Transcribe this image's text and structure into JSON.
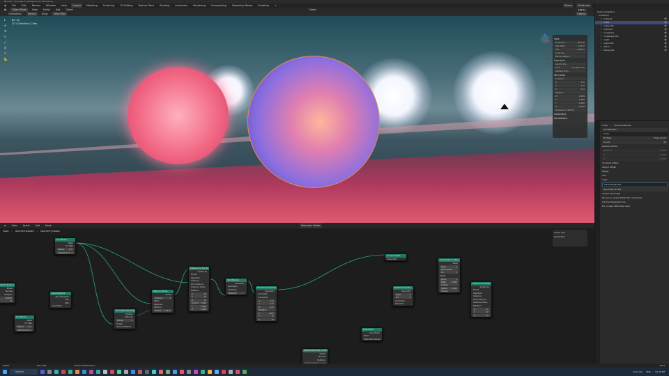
{
  "title": "Blender* [D:\\August 2023\\geonode ball.blend]",
  "menu": [
    "File",
    "Edit",
    "Render",
    "Window",
    "Help"
  ],
  "workspaces": [
    "Layout",
    "Modeling",
    "Sculpting",
    "UV Editing",
    "Texture Paint",
    "Shading",
    "Animation",
    "Rendering",
    "Compositing",
    "Geometry Nodes",
    "Scripting",
    "+"
  ],
  "scene": {
    "label": "Scene",
    "view_layer": "ViewLayer"
  },
  "viewport_header": {
    "mode": "Object Mode",
    "menus": [
      "View",
      "Select",
      "Add",
      "Object"
    ],
    "orientation_global": "Global",
    "options": "Options"
  },
  "tool_settings": {
    "orientation_label": "Orientation:",
    "orientation": "Default",
    "drag_label": "Drag:",
    "drag": "Select Box"
  },
  "viewport_overlay": {
    "line1": "Bx: 14",
    "line2": "(17) Collection | Cube"
  },
  "npanel": {
    "view_header": "View",
    "fields": [
      {
        "k": "Focal Len...",
        "v": "50 mm"
      },
      {
        "k": "Clip Start",
        "v": "0.01 m"
      },
      {
        "k": "End",
        "v": "1000 m"
      }
    ],
    "local_camera": "Local Ca...",
    "render_region": "Render Region",
    "view_lock": "View Lock",
    "lock_to_obj": "Lock to Ob...",
    "lock": "Lock",
    "to_cursor": "To 3D Cursor",
    "camera_to_view": "Camera to Vi...",
    "cursor_header": "3D Cursor",
    "location": "Location",
    "loc": [
      {
        "k": "X",
        "v": "0 m"
      },
      {
        "k": "Y",
        "v": "0 m"
      },
      {
        "k": "Z",
        "v": "0 m"
      }
    ],
    "rotation": "Rotation",
    "rot": [
      {
        "k": "W",
        "v": "0.000"
      },
      {
        "k": "X",
        "v": "0.000"
      },
      {
        "k": "Y",
        "v": "0.000"
      },
      {
        "k": "Z",
        "v": "0.000"
      }
    ],
    "rot_mode": "Quaternion (WXYZ)",
    "collections": "Collections",
    "annotations": "Annotations"
  },
  "outliner": {
    "root": "Scene Collection",
    "collection": "Collection",
    "items": [
      "Camera",
      "Cube",
      "Cube.001",
      "Cylinder",
      "Icosphere",
      "Icosphere.001",
      "Light",
      "Light.001",
      "Plane",
      "Plane.001"
    ],
    "selected": 1
  },
  "properties": {
    "object": "Cube",
    "modifier_name": "GeometryNodes",
    "add_modifier": "Add Modifier",
    "array": {
      "name": "Array",
      "fit_type_label": "Fit Type",
      "fit_type": "Fixed Count",
      "count_label": "Count",
      "count": "10",
      "relative_offset": "Relative Offset",
      "factors": [
        {
          "k": "Factor X",
          "v": "1.000"
        },
        {
          "k": "Y",
          "v": "0.000"
        },
        {
          "k": "Z",
          "v": "0.000"
        }
      ],
      "constant_offset": "Constant Offset",
      "object_offset": "Object Offset",
      "merge": "Merge",
      "uvs": "UVs",
      "caps": "Caps"
    },
    "geonodes": {
      "name": "GeometryNodes",
      "tree": "Geometry Nodes",
      "output_attributes": "Output Attributes",
      "no_group_output": "No group output attributes connected",
      "internal_dependencies": "Internal Dependencies",
      "no_unused": "No unused attributes used"
    }
  },
  "node_editor": {
    "menus": [
      "View",
      "Select",
      "Add",
      "Node"
    ],
    "tree": "Geometry Nodes",
    "breadcrumbs": [
      "Cube",
      "GeometryNodes",
      "Geometry Nodes"
    ],
    "sidebar": {
      "header": "Active Tool",
      "tool": "Select Box"
    },
    "nodes": [
      {
        "title": "Distribute Points on Faces",
        "out": [
          "Points",
          "Normal",
          "Rotation"
        ],
        "vals": [
          {
            "k": "",
            "v": "10.000"
          },
          {
            "k": "",
            "v": "0"
          }
        ]
      },
      {
        "title": "Ico Sphere",
        "out": [
          "Mesh",
          "UV Map"
        ],
        "vals": [
          {
            "k": "Radius",
            "v": "1 m"
          },
          {
            "k": "Subdivisions",
            "v": "3"
          }
        ]
      },
      {
        "title": "Bounding Box",
        "out": [
          "Bounding Box",
          "Min",
          "Max"
        ],
        "in": [
          "Geometry"
        ]
      },
      {
        "title": "Ico Sphere",
        "out": [
          "Mesh",
          "UV Map"
        ],
        "vals": [
          {
            "k": "Radius",
            "v": "1 m"
          },
          {
            "k": "Subdivisions",
            "v": "1"
          }
        ]
      },
      {
        "title": "Geometry Proximity",
        "out": [
          "Position",
          "Distance"
        ],
        "mode": "Points",
        "in": [
          "Target",
          "Source Position"
        ]
      },
      {
        "title": "Mesh to Points",
        "out": [
          "Points"
        ],
        "mode": "Vertices",
        "in": [
          "Mesh",
          "Selection",
          "Position"
        ],
        "vals": [
          {
            "k": "Radius",
            "v": "0.05 m"
          }
        ]
      },
      {
        "title": "Instance on Points",
        "out": [
          "Instances"
        ],
        "in": [
          "Points",
          "Selection",
          "Instance",
          "Pick Instance",
          "Instance Index",
          "Rotation"
        ],
        "vals": [
          {
            "k": "X",
            "v": "0°"
          },
          {
            "k": "Y",
            "v": "0°"
          },
          {
            "k": "Z",
            "v": "0°"
          },
          {
            "k": "Scale X",
            "v": "1.000"
          },
          {
            "k": "Y",
            "v": "1.000"
          },
          {
            "k": "Z",
            "v": "1.000"
          }
        ]
      },
      {
        "title": "Set Material",
        "out": [
          "Geometry"
        ],
        "in": [
          "Geometry",
          "Selection"
        ],
        "vals": [
          {
            "k": "Material",
            "v": ""
          }
        ]
      },
      {
        "title": "Transform Geometry",
        "out": [
          "Geometry"
        ],
        "in": [
          "Geometry",
          "Translation"
        ],
        "vals": [
          {
            "k": "X",
            "v": "0 m"
          },
          {
            "k": "Y",
            "v": "0 m"
          },
          {
            "k": "Z",
            "v": "0 m"
          },
          {
            "k": "Rotation",
            "v": ""
          },
          {
            "k": "X",
            "v": "360°"
          },
          {
            "k": "Y",
            "v": "0°"
          },
          {
            "k": "Z",
            "v": "0°"
          }
        ]
      },
      {
        "title": "Group Output",
        "in": [
          "Geometry"
        ]
      },
      {
        "title": "Delete Geometry",
        "out": [
          "Geometry"
        ],
        "mode": "Edge",
        "mode2": "All",
        "in": [
          "Geometry",
          "Selection"
        ]
      },
      {
        "title": "Subdivision Surface",
        "out": [
          "Mesh"
        ],
        "mode": "Keep Boundaries",
        "mode2": "All",
        "in": [
          "Mesh"
        ],
        "vals": [
          {
            "k": "Level",
            "v": "1"
          },
          {
            "k": "Edge Crease",
            "v": "0.000"
          },
          {
            "k": "Vertex Crease",
            "v": "0.000"
          }
        ]
      },
      {
        "title": "Instance on Points",
        "out": [
          "Instances"
        ],
        "in": [
          "Points",
          "Selection",
          "Instance",
          "Pick Instance",
          "Instance Index",
          "Rotation"
        ],
        "vals": [
          {
            "k": "X",
            "v": "0°"
          },
          {
            "k": "Y",
            "v": "0°"
          },
          {
            "k": "Z",
            "v": "0°"
          }
        ]
      },
      {
        "title": "Dual Mesh",
        "out": [
          "Dual Mesh"
        ],
        "in": [
          "Mesh",
          "Keep Boundaries"
        ]
      },
      {
        "title": "Distribute Points on Faces",
        "out": [
          "Points",
          "Normal",
          "Rotation"
        ],
        "mode": "Poisson Disk"
      }
    ]
  },
  "status": {
    "select": "Select",
    "pan": "Pan View",
    "context": "Node Context Menu",
    "version": "3.6.2"
  },
  "taskbar": {
    "search": "Search",
    "lang": "ENG",
    "time": "10:00 PM",
    "weather": "Overcast"
  },
  "colors": {
    "accent": "#1f7a66",
    "selected": "#3c4a7a",
    "wire": "#2aa58a"
  }
}
